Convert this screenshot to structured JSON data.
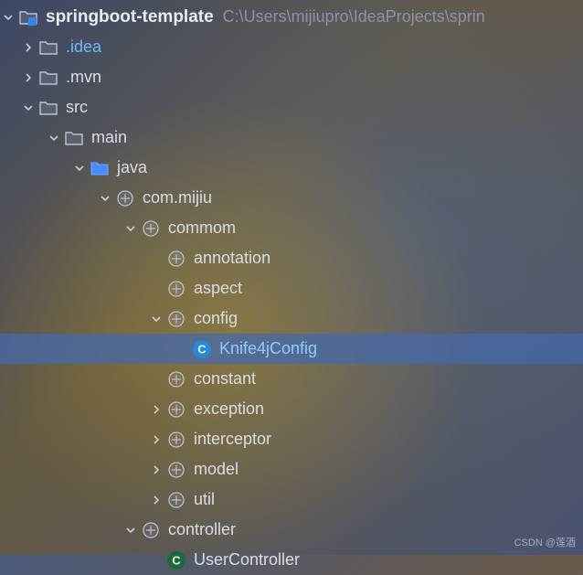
{
  "root": {
    "name": "springboot-template",
    "path": "C:\\Users\\mijiupro\\IdeaProjects\\sprin"
  },
  "tree": {
    "idea": ".idea",
    "mvn": ".mvn",
    "src": "src",
    "main": "main",
    "java": "java",
    "package_root": "com.mijiu",
    "commom": "commom",
    "annotation": "annotation",
    "aspect": "aspect",
    "config": "config",
    "knife4j": "Knife4jConfig",
    "constant": "constant",
    "exception": "exception",
    "interceptor": "interceptor",
    "model": "model",
    "util": "util",
    "controller": "controller",
    "user_controller": "UserController"
  },
  "watermark": "CSDN @莲酒"
}
